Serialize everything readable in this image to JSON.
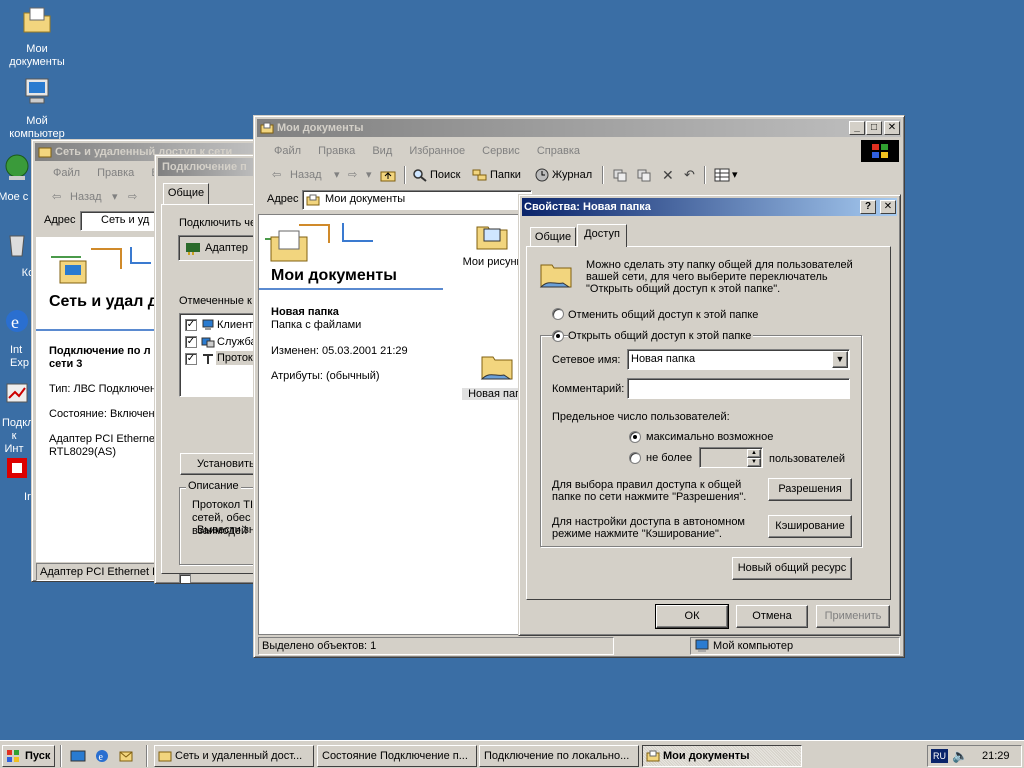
{
  "desktop": {
    "icons": [
      {
        "label": "Мои документы"
      },
      {
        "label": "Мой компьютер"
      },
      {
        "label": "Мое с окру"
      },
      {
        "label": "Кор"
      },
      {
        "label": "Int Exp"
      },
      {
        "label": "Подкл к Инт"
      },
      {
        "label": "Irfa"
      }
    ]
  },
  "win_network": {
    "title": "Сеть и удаленный доступ к сети",
    "menu": [
      "Файл",
      "Правка",
      "В"
    ],
    "back_label": "Назад",
    "address_label": "Адрес",
    "address_value": "Сеть и уд",
    "heading": "Сеть и удал доступ к сет",
    "conn_name": "Подключение по л сети 3",
    "type_line": "Тип: ЛВС Подключен",
    "state_line": "Состояние: Включен",
    "adapter_line": "Адаптер PCI Etherne RTL8029(AS)",
    "status": "Адаптер PCI Ethernet R"
  },
  "win_connection": {
    "title": "Подключение п",
    "tab_general": "Общие",
    "connect_using": "Подключить че",
    "adapter": "Адаптер",
    "checked_components": "Отмеченные к",
    "components": [
      "Клиент",
      "Служба",
      "Протоко"
    ],
    "install_button": "Установить",
    "description_label": "Описание",
    "description_text": "Протокол TI сетей, обес взаимодей",
    "show_icon_label": "Вывести зн"
  },
  "win_mydocs": {
    "title": "Мои документы",
    "menu": [
      "Файл",
      "Правка",
      "Вид",
      "Избранное",
      "Сервис",
      "Справка"
    ],
    "toolbar": {
      "back": "Назад",
      "search": "Поиск",
      "folders": "Папки",
      "history": "Журнал"
    },
    "address_label": "Адрес",
    "address_value": "Мои документы",
    "panel_title": "Мои документы",
    "selected_name": "Новая папка",
    "selected_type": "Папка с файлами",
    "modified": "Изменен: 05.03.2001 21:29",
    "attributes": "Атрибуты: (обычный)",
    "items": [
      {
        "label": "Мои рисунк"
      },
      {
        "label": "Новая папк"
      }
    ],
    "status_left": "Выделено объектов: 1",
    "status_right": "Мой компьютер"
  },
  "dialog": {
    "title": "Свойства: Новая папка",
    "help_glyph": "?",
    "close_glyph": "✕",
    "tabs": [
      "Общие",
      "Доступ"
    ],
    "intro": "Можно сделать эту папку общей для пользователей вашей сети, для чего выберите переключатель \"Открыть общий доступ к этой папке\".",
    "radio_unshare": "Отменить общий доступ к этой папке",
    "radio_share": "Открыть общий доступ к этой папке",
    "share_name_label": "Сетевое имя:",
    "share_name_value": "Новая папка",
    "comment_label": "Комментарий:",
    "comment_value": "",
    "user_limit_label": "Предельное число пользователей:",
    "max_allowed": "максимально возможное",
    "allow_label": "не более",
    "users_suffix": "пользователей",
    "permissions_text": "Для выбора правил доступа к общей папке по сети нажмите \"Разрешения\".",
    "permissions_button": "Разрешения",
    "caching_text": "Для настройки доступа в автономном режиме нажмите \"Кэширование\".",
    "caching_button": "Кэширование",
    "new_share_button": "Новый общий ресурс",
    "ok": "ОК",
    "cancel": "Отмена",
    "apply": "Применить"
  },
  "taskbar": {
    "start": "Пуск",
    "tasks": [
      {
        "label": "Сеть и удаленный дост..."
      },
      {
        "label": "Состояние Подключение п..."
      },
      {
        "label": "Подключение по локально..."
      },
      {
        "label": "Мои документы"
      }
    ],
    "lang": "RU",
    "clock": "21:29"
  },
  "colors": {
    "desktop": "#3a6ea5",
    "title_active": "#0a246a",
    "title_inactive": "#808080",
    "face": "#d4d0c8"
  }
}
